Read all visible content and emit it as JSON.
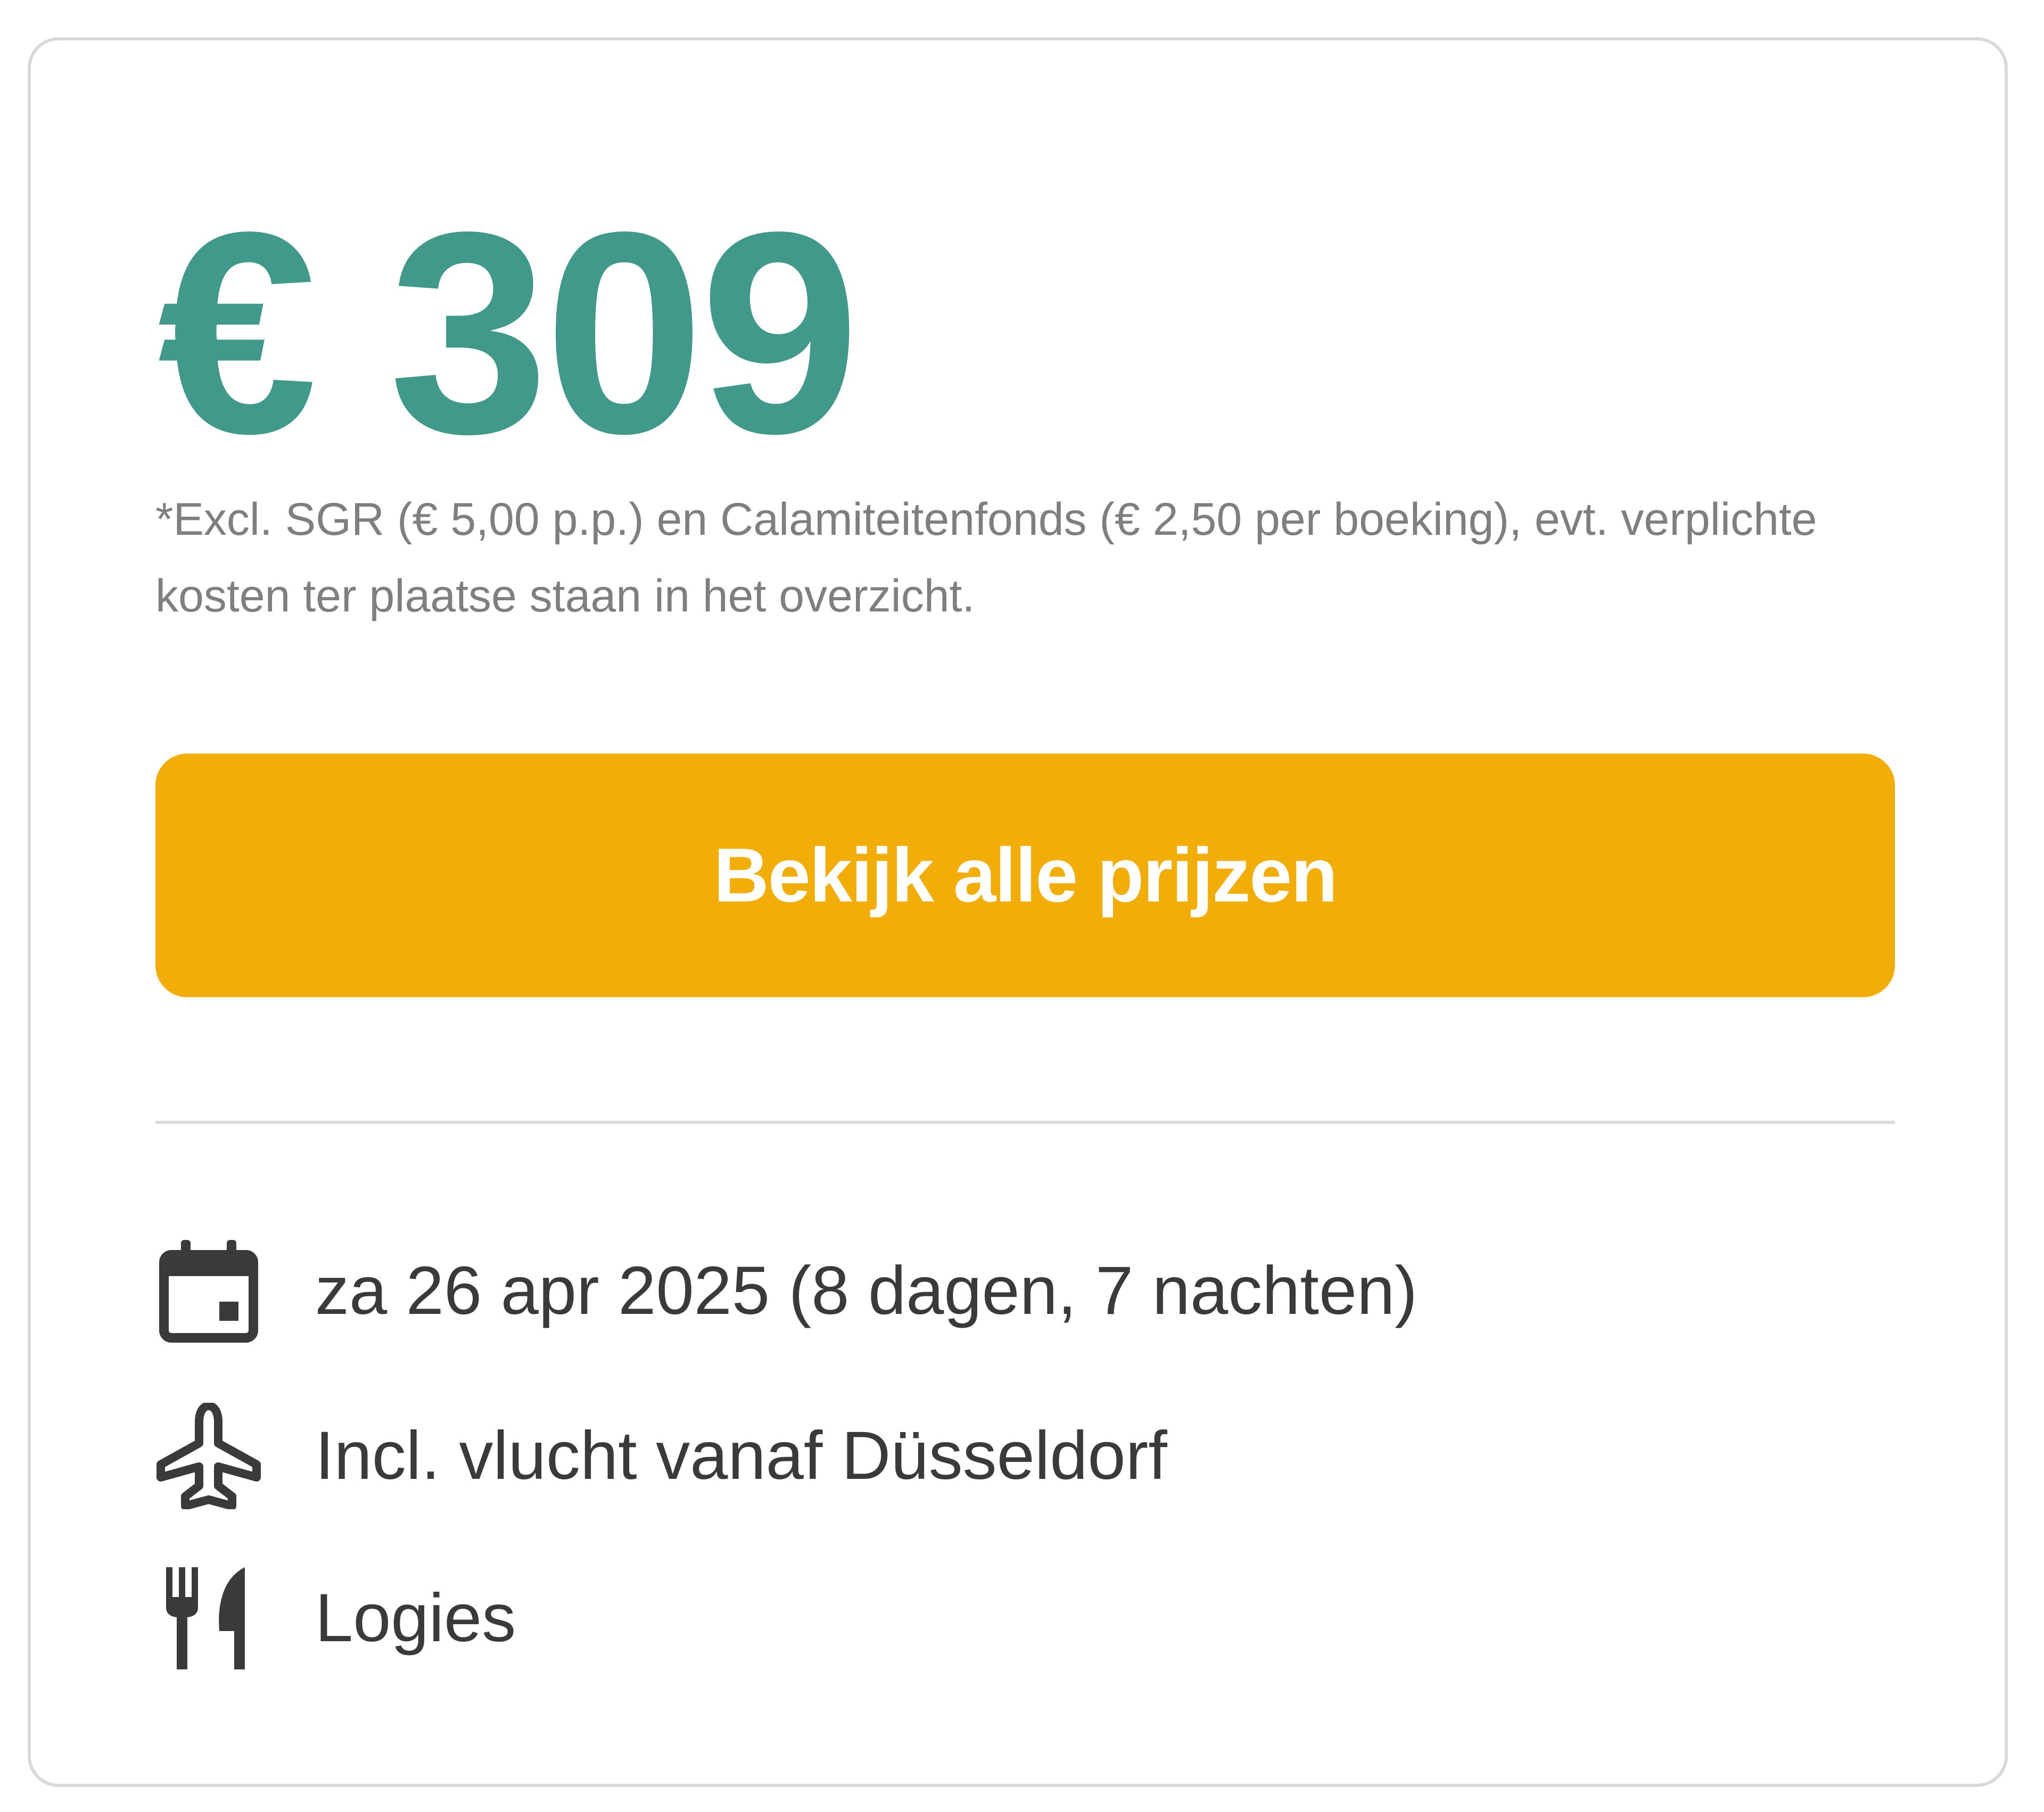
{
  "price": {
    "amount": "€ 309",
    "disclaimer": "*Excl. SGR (€ 5,00 p.p.) en Calamiteitenfonds (€ 2,50 per boeking), evt. verplichte kosten ter plaatse staan in het overzicht."
  },
  "cta": {
    "label": "Bekijk alle prijzen"
  },
  "features": [
    {
      "icon": "calendar-icon",
      "text": "za 26 apr 2025 (8 dagen, 7 nachten)"
    },
    {
      "icon": "airplane-icon",
      "text": "Incl. vlucht vanaf Düsseldorf"
    },
    {
      "icon": "fork-knife-icon",
      "text": "Logies"
    }
  ],
  "colors": {
    "price": "#40998a",
    "button": "#f2ad08",
    "text": "#3a3a3a",
    "muted": "#7f7f7f"
  }
}
